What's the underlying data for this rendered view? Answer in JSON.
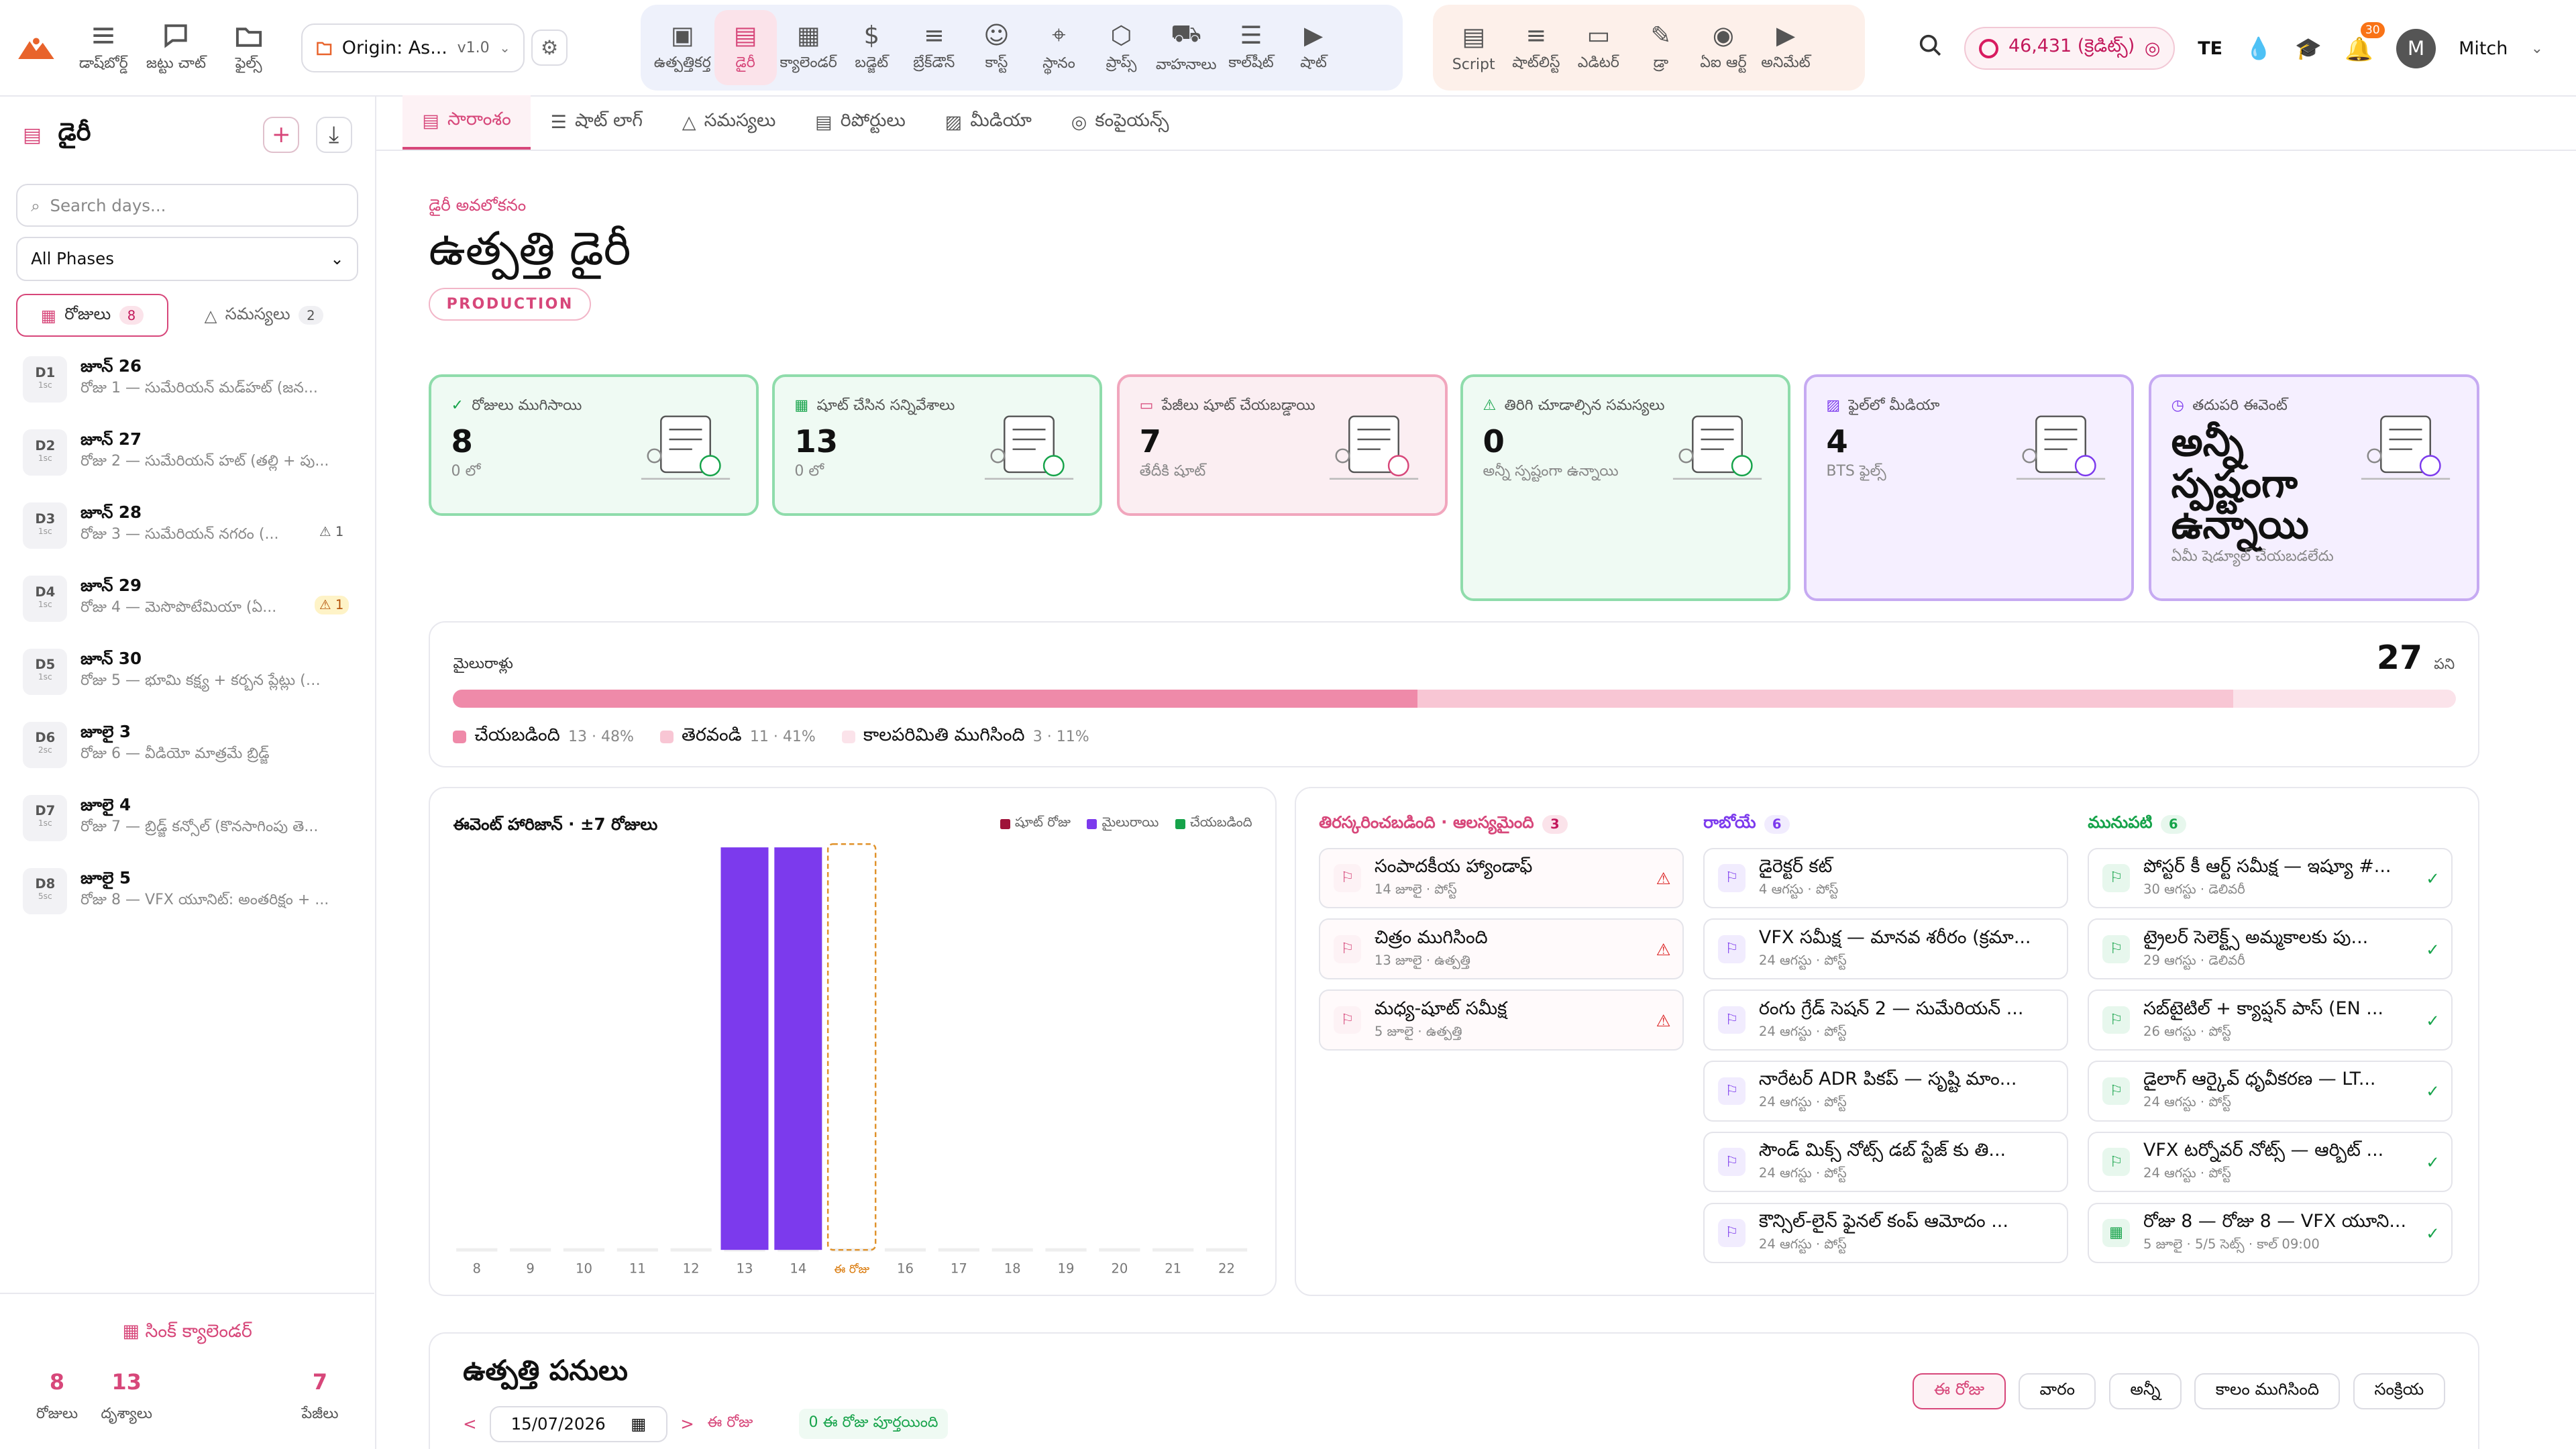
{
  "brand": {
    "accent": "#d7477a"
  },
  "nav": {
    "dashboard": "డాష్‌బోర్డ్",
    "team_chat": "జట్టు చాట్",
    "files": "ఫైల్స్"
  },
  "project": {
    "name": "Origin: As...",
    "version": "v1.0"
  },
  "tools_group1": [
    "ఉత్పత్తికర్త",
    "డైరీ",
    "క్యాలెండర్",
    "బడ్జెట్",
    "బ్రేక్‌డౌన్",
    "కాస్ట్",
    "స్థానం",
    "ప్రాప్స్",
    "వాహనాలు",
    "కాల్‌షీట్",
    "షాట్"
  ],
  "tools_group2": [
    "Script",
    "షాట్‌లిస్ట్",
    "ఎడిటర్",
    "డ్రా",
    "ఏఐ ఆర్ట్",
    "అనిమేట్"
  ],
  "header": {
    "credits": "46,431 (క్రెడిట్స్)",
    "lang": "TE",
    "notif_count": "30",
    "user_initial": "M",
    "user_name": "Mitch"
  },
  "sidebar": {
    "title": "డైరీ",
    "search_placeholder": "Search days...",
    "phase": "All Phases",
    "tab_days": "రోజులు",
    "tab_days_count": "8",
    "tab_issues": "సమస్యలు",
    "tab_issues_count": "2",
    "days": [
      {
        "code": "D1",
        "sub": "1sc",
        "date": "జూన్ 26",
        "desc": "రోజు 1 — సుమేరియన్ మడ్‌హట్ (జన...",
        "warn": ""
      },
      {
        "code": "D2",
        "sub": "1sc",
        "date": "జూన్ 27",
        "desc": "రోజు 2 — సుమేరియన్ హట్ (తల్లి + పు...",
        "warn": ""
      },
      {
        "code": "D3",
        "sub": "1sc",
        "date": "జూన్ 28",
        "desc": "రోజు 3 — సుమేరియన్ నగరం (...",
        "warn": "1"
      },
      {
        "code": "D4",
        "sub": "1sc",
        "date": "జూన్ 29",
        "desc": "రోజు 4 — మెసొపొటేమియా (ఏ...",
        "warn": "1"
      },
      {
        "code": "D5",
        "sub": "1sc",
        "date": "జూన్ 30",
        "desc": "రోజు 5 — భూమి కక్ష్య + కర్బన ప్లేట్లు (వా...",
        "warn": ""
      },
      {
        "code": "D6",
        "sub": "2sc",
        "date": "జూలై 3",
        "desc": "రోజు 6 — వీడియో మాత్రమే బ్రిడ్జ్",
        "warn": ""
      },
      {
        "code": "D7",
        "sub": "1sc",
        "date": "జూలై 4",
        "desc": "రోజు 7 — బ్రిడ్జ్ కన్సోల్ (కొనసాగింపు తె...",
        "warn": ""
      },
      {
        "code": "D8",
        "sub": "5sc",
        "date": "జూలై 5",
        "desc": "రోజు 8 — VFX యూనిట్: అంతరిక్షం + ...",
        "warn": ""
      }
    ],
    "sync": "సింక్ క్యాలెండర్",
    "stats": [
      {
        "v": "8",
        "l": "రోజులు"
      },
      {
        "v": "13",
        "l": "దృశ్యాలు"
      },
      {
        "v": "7",
        "l": "పేజీలు"
      }
    ]
  },
  "tabs": [
    "సారాంశం",
    "షాట్ లాగ్",
    "సమస్యలు",
    "రిపోర్టులు",
    "మీడియా",
    "కంపైయన్స్"
  ],
  "page": {
    "overline": "డైరీ అవలోకనం",
    "title": "ఉత్పత్తి డైరీ",
    "tag": "PRODUCTION"
  },
  "cards": [
    {
      "label": "రోజులు ముగిసాయి",
      "value": "8",
      "sub": "0 లో"
    },
    {
      "label": "షూట్ చేసిన సన్నివేశాలు",
      "value": "13",
      "sub": "0 లో"
    },
    {
      "label": "పేజీలు షూట్ చేయబడ్డాయి",
      "value": "7",
      "sub": "తేదీకి షూట్"
    },
    {
      "label": "తిరిగి చూడాల్సిన సమస్యలు",
      "value": "0",
      "sub": "అన్నీ స్పష్టంగా ఉన్నాయి"
    },
    {
      "label": "ఫైల్‌లో మీడియా",
      "value": "4",
      "sub": "BTS ఫైల్స్"
    },
    {
      "label": "తదుపరి ఈవెంట్",
      "value": "అన్నీ స్పష్టంగా ఉన్నాయి",
      "sub": "ఏమీ షెడ్యూల్ చేయబడలేదు"
    }
  ],
  "milestones": {
    "label": "మైలురాళ్లు",
    "total": "27",
    "unit": "పని",
    "done": 13,
    "open": 11,
    "over": 3,
    "legend": [
      {
        "l": "చేయబడింది",
        "v": "13 · 48%"
      },
      {
        "l": "తెరవండి",
        "v": "11 · 41%"
      },
      {
        "l": "కాలపరిమితి ముగిసింది",
        "v": "3 · 11%"
      }
    ],
    "colors": [
      "#ef8aa9",
      "#f8c6d4",
      "#fbe3ea"
    ]
  },
  "chart_data": {
    "type": "bar",
    "title": "ఈవెంట్ హారిజాన్ · ±7 రోజులు",
    "categories": [
      "8",
      "9",
      "10",
      "11",
      "12",
      "13",
      "14",
      "ఈ రోజు",
      "16",
      "17",
      "18",
      "19",
      "20",
      "21",
      "22"
    ],
    "series": [
      {
        "name": "షూట్ రోజు",
        "values": [
          0,
          0,
          0,
          0,
          0,
          0,
          0,
          0,
          0,
          0,
          0,
          0,
          0,
          0,
          0
        ],
        "color": "#9f1239"
      },
      {
        "name": "మైలురాయి",
        "values": [
          0,
          0,
          0,
          0,
          0,
          1,
          1,
          0,
          0,
          0,
          0,
          0,
          0,
          0,
          0
        ],
        "color": "#7c3aed"
      },
      {
        "name": "చేయబడింది",
        "values": [
          0,
          0,
          0,
          0,
          0,
          0,
          0,
          0,
          0,
          0,
          0,
          0,
          0,
          0,
          0
        ],
        "color": "#16a34a"
      }
    ],
    "today_index": 7
  },
  "columns": [
    {
      "title": "తిరస్కరించబడింది · ఆలస్యమైంది",
      "count": "3",
      "items": [
        {
          "a": "సంపాదకీయ హ్యాండాఫ్",
          "b": "14 జూలై · పోస్ట్"
        },
        {
          "a": "చిత్రం ముగిసింది",
          "b": "13 జూలై · ఉత్పత్తి"
        },
        {
          "a": "మధ్య-షూట్ సమీక్ష",
          "b": "5 జూలై · ఉత్పత్తి"
        }
      ]
    },
    {
      "title": "రాబోయే",
      "count": "6",
      "items": [
        {
          "a": "డైరెక్టర్ కట్",
          "b": "4 ఆగస్టు · పోస్ట్"
        },
        {
          "a": "VFX సమీక్ష — మానవ శరీరం (క్రమా...",
          "b": "24 ఆగస్టు · పోస్ట్"
        },
        {
          "a": "రంగు గ్రేడ్ సెషన్ 2 — సుమేరియన్ ...",
          "b": "24 ఆగస్టు · పోస్ట్"
        },
        {
          "a": "నారేటర్ ADR పికప్ — సృష్టి మాం...",
          "b": "24 ఆగస్టు · పోస్ట్"
        },
        {
          "a": "సౌండ్ మిక్స్ నోట్స్ డబ్ స్టేజ్ కు తి...",
          "b": "24 ఆగస్టు · పోస్ట్"
        },
        {
          "a": "కౌన్సిల్-లైన్ ఫైనల్ కంప్ ఆమోదం ...",
          "b": "24 ఆగస్టు · పోస్ట్"
        }
      ]
    },
    {
      "title": "మునుపటి",
      "count": "6",
      "items": [
        {
          "a": "పోస్టర్ కీ ఆర్ట్ సమీక్ష — ఇష్యూ #...",
          "b": "30 ఆగస్టు · డెలివరీ"
        },
        {
          "a": "ట్రైలర్ సెలెక్ట్స్ అమ్మకాలకు పు...",
          "b": "29 ఆగస్టు · డెలివరీ"
        },
        {
          "a": "సబ్‌టైటిల్ + క్యాప్షన్ పాస్ (EN ...",
          "b": "26 ఆగస్టు · పోస్ట్"
        },
        {
          "a": "డైలాగ్ ఆర్కైవ్ ధృవీకరణ — LT...",
          "b": "24 ఆగస్టు · పోస్ట్"
        },
        {
          "a": "VFX టర్నోవర్ నోట్స్ — ఆర్బిట్ ...",
          "b": "24 ఆగస్టు · పోస్ట్"
        },
        {
          "a": "రోజు 8 — రోజు 8 — VFX యూని...",
          "b": "5 జూలై · 5/5 సెట్స్ · కాల్ 09:00"
        }
      ]
    }
  ],
  "tasks": {
    "title": "ఉత్పత్తి పనులు",
    "date": "15/07/2026",
    "today": "ఈ రోజు",
    "done_today": "0 ఈ రోజు పూర్తయింది",
    "filters": [
      "ఈ రోజు",
      "వారం",
      "అన్నీ",
      "కాలం ముగిసింది",
      "సంక్రియ"
    ]
  }
}
